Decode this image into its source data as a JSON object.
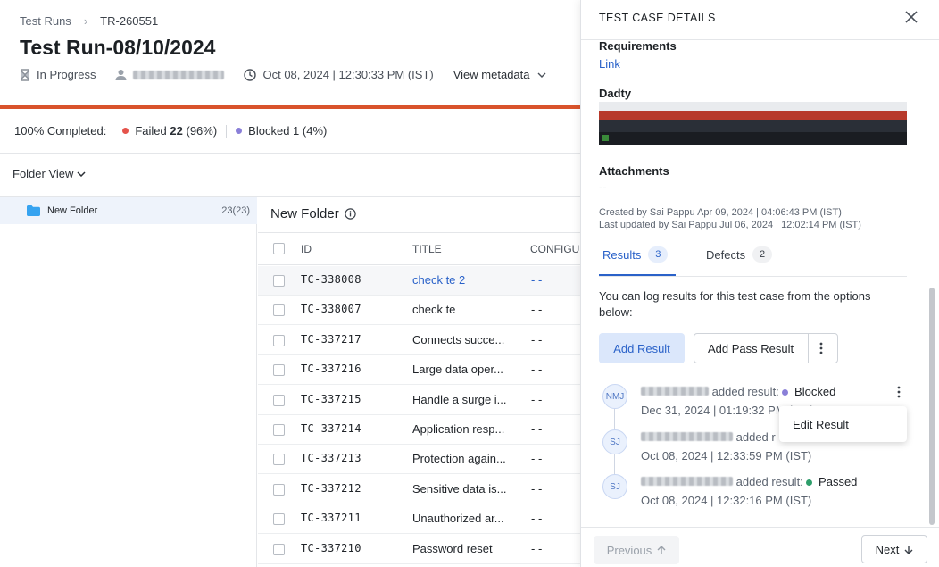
{
  "breadcrumb": {
    "root": "Test Runs",
    "separator": "›",
    "current": "TR-260551"
  },
  "run": {
    "title": "Test Run-08/10/2024",
    "status": "In Progress",
    "date": "Oct 08, 2024 | 12:30:33 PM (IST)",
    "view_metadata": "View metadata"
  },
  "summary": {
    "completed": "100% Completed:",
    "failed_label": "Failed",
    "failed_count": "22",
    "failed_pct": "(96%)",
    "blocked_label": "Blocked",
    "blocked_count": "1",
    "blocked_pct": "(4%)"
  },
  "folder_view": "Folder View",
  "folder": {
    "name": "New Folder",
    "count": "23(23)"
  },
  "table": {
    "title": "New Folder",
    "columns": {
      "id": "ID",
      "title": "TITLE",
      "config": "CONFIGU"
    },
    "rows": [
      {
        "id": "TC-338008",
        "title": "check te 2",
        "config": "- -"
      },
      {
        "id": "TC-338007",
        "title": "check te",
        "config": "- -"
      },
      {
        "id": "TC-337217",
        "title": "Connects succe...",
        "config": "- -"
      },
      {
        "id": "TC-337216",
        "title": "Large data oper...",
        "config": "- -"
      },
      {
        "id": "TC-337215",
        "title": "Handle a surge i...",
        "config": "- -"
      },
      {
        "id": "TC-337214",
        "title": "Application resp...",
        "config": "- -"
      },
      {
        "id": "TC-337213",
        "title": "Protection again...",
        "config": "- -"
      },
      {
        "id": "TC-337212",
        "title": "Sensitive data is...",
        "config": "- -"
      },
      {
        "id": "TC-337211",
        "title": "Unauthorized ar...",
        "config": "- -"
      },
      {
        "id": "TC-337210",
        "title": "Password reset",
        "config": "- -"
      }
    ]
  },
  "panel": {
    "title": "TEST CASE DETAILS",
    "requirements_label": "Requirements",
    "requirements_link": "Link",
    "dadty_label": "Dadty",
    "attachments_label": "Attachments",
    "attachments_value": "--",
    "created": "Created by Sai Pappu Apr 09, 2024 | 04:06:43 PM (IST)",
    "updated": "Last updated by Sai Pappu Jul 06, 2024 | 12:02:14 PM (IST)",
    "tabs": [
      {
        "label": "Results",
        "count": "3"
      },
      {
        "label": "Defects",
        "count": "2"
      }
    ],
    "hint": "You can log results for this test case from the options below:",
    "add_result": "Add Result",
    "add_pass_result": "Add Pass Result",
    "results": [
      {
        "initials": "NMJ",
        "action": "added result:",
        "status": "Blocked",
        "time": "Dec 31, 2024 | 01:19:32 PM (IST)"
      },
      {
        "initials": "SJ",
        "action": "added r",
        "status": "",
        "time": "Oct 08, 2024 | 12:33:59 PM (IST)"
      },
      {
        "initials": "SJ",
        "action": "added result:",
        "status": "Passed",
        "time": "Oct 08, 2024 | 12:32:16 PM (IST)"
      }
    ],
    "menu_edit": "Edit Result",
    "previous": "Previous",
    "next": "Next"
  },
  "colors": {
    "accent": "#2a62c9",
    "failed": "#e5534b",
    "blocked": "#8a7fd8",
    "passed": "#2e9e6b",
    "progress": "#d9532b"
  }
}
